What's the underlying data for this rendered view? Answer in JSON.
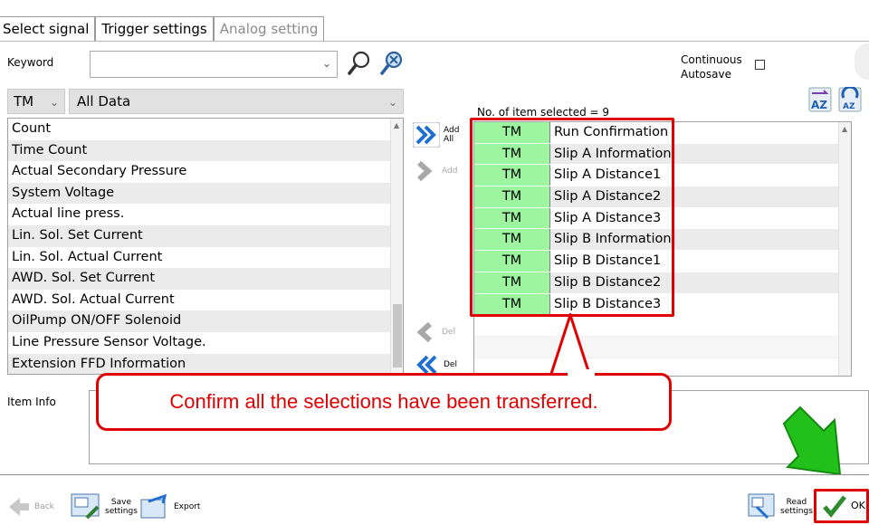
{
  "tabs": [
    {
      "label": "Select signal",
      "active": true
    },
    {
      "label": "Trigger settings",
      "active": false
    },
    {
      "label": "Analog setting",
      "active": false
    }
  ],
  "keyword": {
    "label": "Keyword",
    "value": "",
    "placeholder": ""
  },
  "continuous_autosave": {
    "line1": "Continuous",
    "line2": "Autosave",
    "checked": false
  },
  "filter": {
    "system": "TM",
    "category": "All Data"
  },
  "items_selected_text": "No. of item selected = 9",
  "available_items": [
    "Count",
    "Time Count",
    "Actual Secondary Pressure",
    "System Voltage",
    "Actual line press.",
    "Lin. Sol. Set Current",
    "Lin. Sol. Actual Current",
    "AWD. Sol. Set Current",
    "AWD. Sol. Actual Current",
    "OilPump ON/OFF Solenoid",
    "Line Pressure Sensor Voltage.",
    "Extension FFD Information"
  ],
  "transfer_buttons": {
    "add_all_line1": "Add",
    "add_all_line2": "All",
    "add": "Add",
    "del": "Del",
    "del_all": "Del"
  },
  "selected_items": [
    {
      "system": "TM",
      "name": "Run Confirmation"
    },
    {
      "system": "TM",
      "name": "Slip A Information"
    },
    {
      "system": "TM",
      "name": "Slip A Distance1"
    },
    {
      "system": "TM",
      "name": "Slip A Distance2"
    },
    {
      "system": "TM",
      "name": "Slip A Distance3"
    },
    {
      "system": "TM",
      "name": "Slip B Information"
    },
    {
      "system": "TM",
      "name": "Slip B Distance1"
    },
    {
      "system": "TM",
      "name": "Slip B Distance2"
    },
    {
      "system": "TM",
      "name": "Slip B Distance3"
    }
  ],
  "item_info_label": "Item Info",
  "callout_text": "Confirm all the selections have been transferred.",
  "footer": {
    "back": "Back",
    "save_line1": "Save",
    "save_line2": "settings",
    "export": "Export",
    "read_line1": "Read",
    "read_line2": "settings",
    "ok": "OK"
  },
  "colors": {
    "highlight_red": "#e00000",
    "selected_green": "#9df5a0",
    "arrow_green": "#22c01a"
  }
}
